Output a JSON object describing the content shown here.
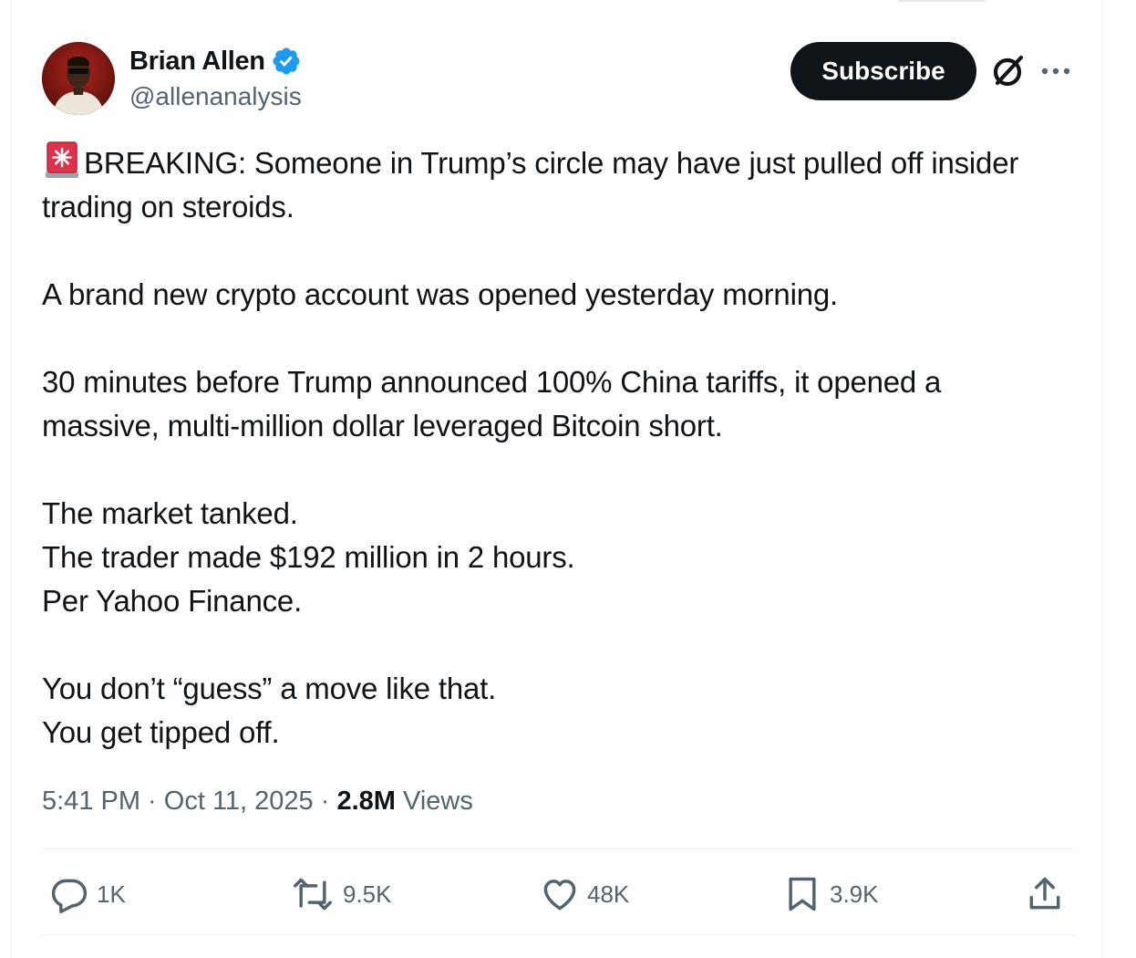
{
  "author": {
    "display_name": "Brian Allen",
    "handle": "@allenanalysis",
    "verified": true
  },
  "header": {
    "subscribe_label": "Subscribe",
    "icons": [
      "grok-icon",
      "more-options-icon"
    ]
  },
  "tweet": {
    "paragraphs": [
      [
        "BREAKING: Someone in Trump’s circle may have just pulled off insider",
        "trading on steroids."
      ],
      [
        "A brand new crypto account was opened yesterday morning."
      ],
      [
        "30 minutes before Trump announced 100% China tariffs, it opened a",
        "massive, multi-million dollar leveraged Bitcoin short."
      ],
      [
        "The market tanked.",
        "The trader made $192 million in 2 hours.",
        "Per Yahoo Finance."
      ],
      [
        "You don’t “guess” a move like that.",
        "You get tipped off."
      ]
    ],
    "lead_emoji": "rotating-light-icon"
  },
  "meta": {
    "time": "5:41 PM",
    "separator": " · ",
    "date": "Oct 11, 2025",
    "views_count": "2.8M",
    "views_label": " Views"
  },
  "actions": {
    "reply_count": "1K",
    "repost_count": "9.5K",
    "like_count": "48K",
    "bookmark_count": "3.9K"
  },
  "colors": {
    "text": "#0f1419",
    "secondary": "#536471",
    "verified_badge": "#1d9bf0",
    "button": "#0f1419",
    "divider": "#eff3f4"
  }
}
